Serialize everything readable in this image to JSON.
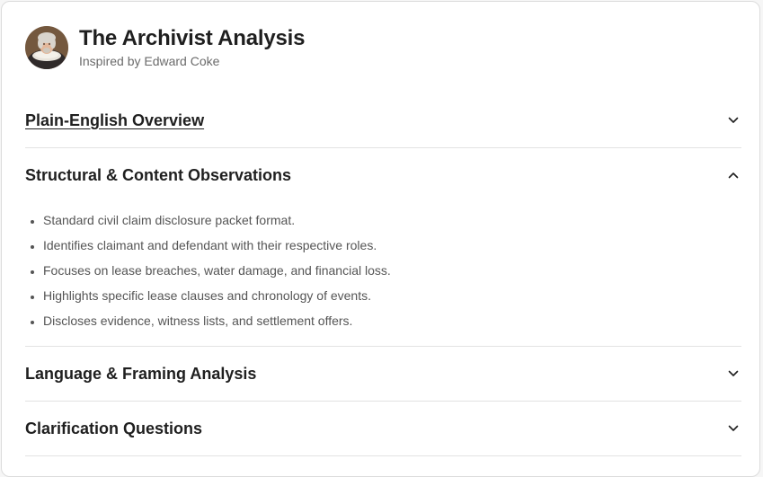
{
  "header": {
    "title": "The Archivist Analysis",
    "subtitle": "Inspired by Edward Coke",
    "avatar_icon": "portrait-avatar"
  },
  "sections": [
    {
      "title": "Plain-English Overview",
      "expanded": false,
      "chevron_icon": "chevron-down-icon"
    },
    {
      "title": "Structural & Content Observations",
      "expanded": true,
      "chevron_icon": "chevron-up-icon",
      "items": [
        "Standard civil claim disclosure packet format.",
        "Identifies claimant and defendant with their respective roles.",
        "Focuses on lease breaches, water damage, and financial loss.",
        "Highlights specific lease clauses and chronology of events.",
        "Discloses evidence, witness lists, and settlement offers."
      ]
    },
    {
      "title": "Language & Framing Analysis",
      "expanded": false,
      "chevron_icon": "chevron-down-icon"
    },
    {
      "title": "Clarification Questions",
      "expanded": false,
      "chevron_icon": "chevron-down-icon"
    }
  ],
  "colors": {
    "text_primary": "#1f1f1f",
    "text_secondary": "#6b6b6b",
    "divider": "#e2e2e2"
  }
}
